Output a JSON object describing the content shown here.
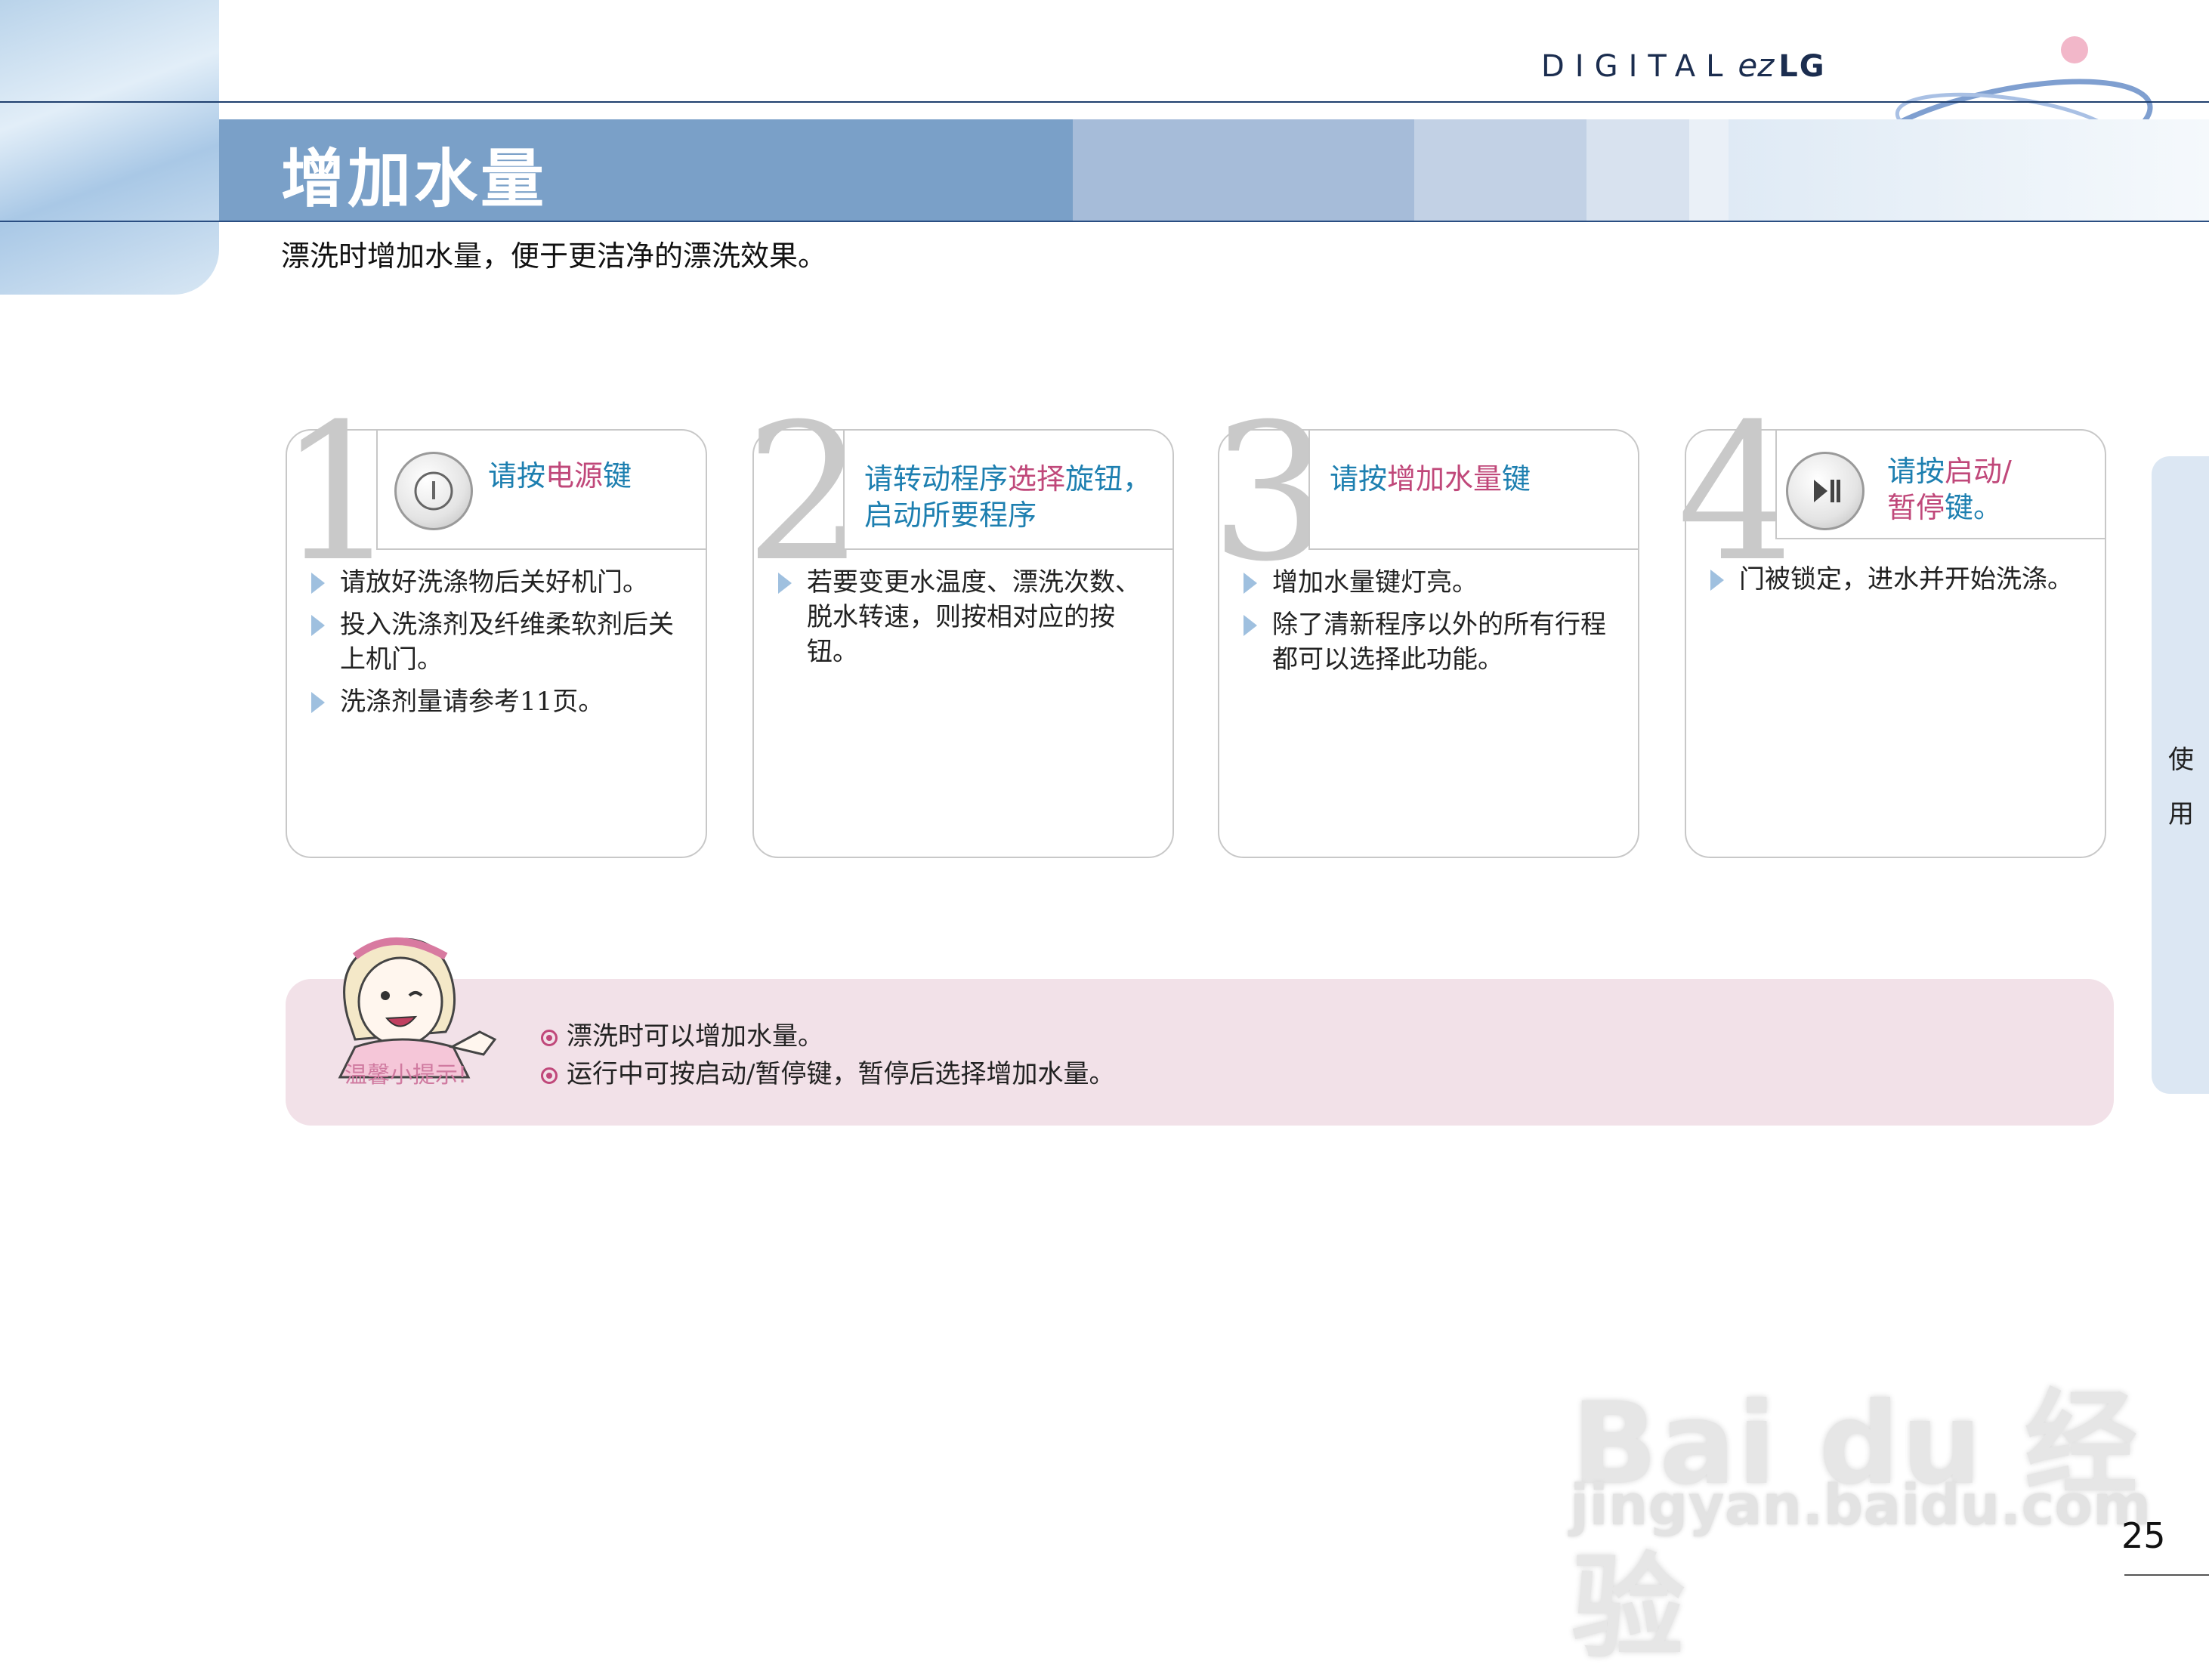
{
  "header": {
    "brand_prefix": "DIGITAL",
    "brand_ez": "ez",
    "brand_suffix": "LG",
    "title": "增加水量",
    "subtitle": "漂洗时增加水量，便于更洁净的漂洗效果。"
  },
  "steps": [
    {
      "number": "1",
      "icon": "power-icon",
      "heading_parts": [
        "请按",
        "电源",
        "键"
      ],
      "bullets": [
        "请放好洗涤物后关好机门。",
        "投入洗涤剂及纤维柔软剂后关上机门。",
        "洗涤剂量请参考11页。"
      ]
    },
    {
      "number": "2",
      "heading_parts": [
        "请转动程序",
        "选择",
        "旋钮，",
        "启动所要程序"
      ],
      "bullets": [
        "若要变更水温度、漂洗次数、脱水转速，则按相对应的按钮。"
      ]
    },
    {
      "number": "3",
      "heading_parts": [
        "请按",
        "增加水量",
        "键"
      ],
      "bullets": [
        "增加水量键灯亮。",
        "除了清新程序以外的所有行程都可以选择此功能。"
      ]
    },
    {
      "number": "4",
      "icon": "play-pause-icon",
      "heading_parts": [
        "请按",
        "启动/",
        "暂停",
        "键。"
      ],
      "bullets": [
        "门被锁定，进水并开始洗涤。"
      ]
    }
  ],
  "tip": {
    "label": "温馨小提示!",
    "lines": [
      "漂洗时可以增加水量。",
      "运行中可按启动/暂停键，暂停后选择增加水量。"
    ]
  },
  "side_tab": {
    "chars": [
      "使",
      "用"
    ]
  },
  "page_number": "25",
  "watermark": {
    "logo": "Bai du 经验",
    "url": "jingyan.baidu.com"
  },
  "colors": {
    "title_band": "#7aa0c8",
    "heading_blue": "#1d7fb0",
    "heading_pink": "#c0487a",
    "tip_bg": "#f2e1e8"
  }
}
